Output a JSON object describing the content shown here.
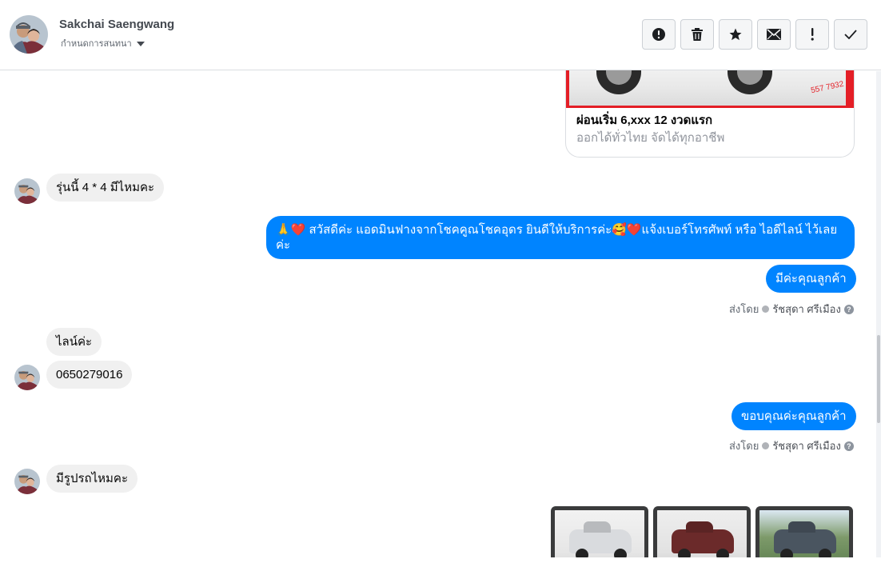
{
  "contact": {
    "name": "Sakchai Saengwang",
    "subtitle": "กำหนดการสนทนา"
  },
  "actions": [
    {
      "name": "report-spam-button",
      "icon": "alert-circle-icon"
    },
    {
      "name": "delete-button",
      "icon": "trash-icon"
    },
    {
      "name": "star-button",
      "icon": "star-icon"
    },
    {
      "name": "mark-unread-button",
      "icon": "envelope-icon"
    },
    {
      "name": "follow-up-button",
      "icon": "exclamation-icon"
    },
    {
      "name": "mark-done-button",
      "icon": "check-icon"
    }
  ],
  "ad": {
    "title": "ผ่อนเริ่ม 6,xxx 12 งวดแรก",
    "description": "ออกได้ทั่วไทย จัดได้ทุกอาชีพ",
    "phone_fragment": "557 7932"
  },
  "messages": {
    "in1": "รุ่นนี้ 4 * 4 มีไหมคะ",
    "out1": "🙏❤️ สวัสดีค่ะ แอดมินฟางจากโชคคูณโชคอุดร ยินดีให้บริการค่ะ🥰❤️แจ้งเบอร์โทรศัพท์ หรือ ไอดีไลน์  ไว้เลยค่ะ",
    "out2": "มีค่ะคุณลูกค้า",
    "in2": "ไลน์ค่ะ",
    "in3": "0650279016",
    "out3": "ขอบคุณค่ะคุณลูกค้า",
    "in4": "มีรูปรถไหมคะ"
  },
  "sent_by": {
    "prefix": "ส่งโดย",
    "agent": "รัชสุดา ศรีเมือง",
    "help": "?"
  },
  "colors": {
    "outgoing_bubble": "#0084ff",
    "incoming_bubble": "#f0f0f0",
    "ad_banner": "#e41e26"
  }
}
